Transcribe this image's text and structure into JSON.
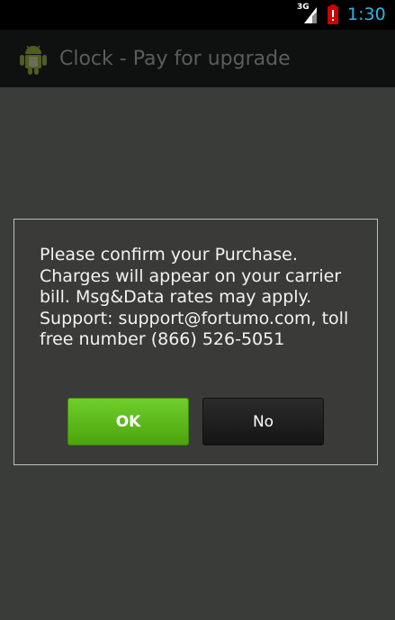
{
  "status_bar": {
    "network_label": "3G",
    "time": "1:30",
    "time_color": "#33b5e5",
    "battery_color": "#cc0000",
    "icons": [
      "signal-icon",
      "battery-alert-icon"
    ]
  },
  "action_bar": {
    "title": "Clock - Pay for upgrade",
    "icon": "android-icon"
  },
  "dialog": {
    "message": "Please confirm your Purchase. Charges will appear on your carrier bill. Msg&Data rates may apply. Support: support@fortumo.com, toll free number (866) 526-5051",
    "ok_label": "OK",
    "no_label": "No",
    "ok_color": "#5cb81a"
  }
}
